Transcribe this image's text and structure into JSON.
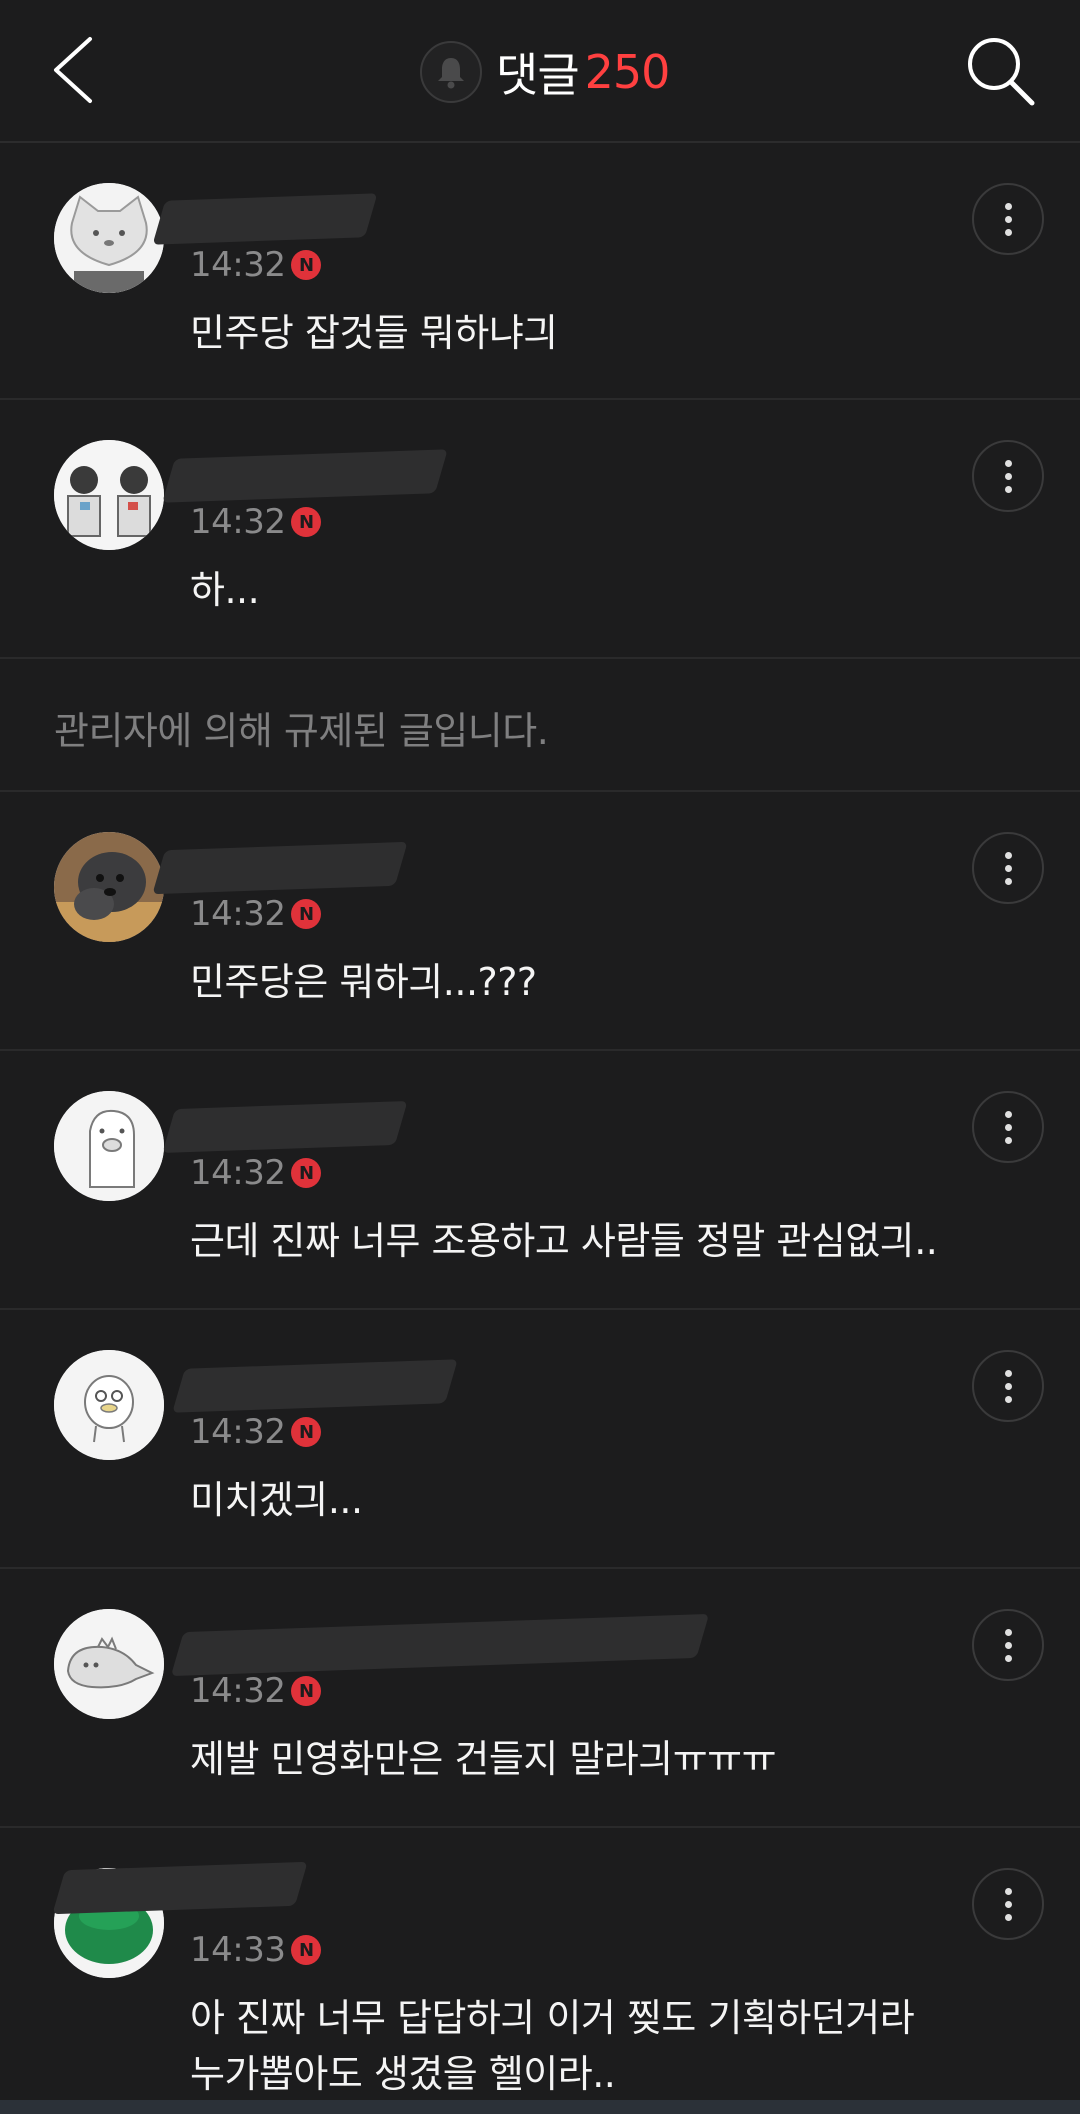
{
  "header": {
    "title": "댓글",
    "count": "250",
    "count_color": "#ff4040",
    "back_icon": "chevron-left-icon",
    "bell_icon": "bell-icon",
    "search_icon": "search-icon"
  },
  "blocked_notice": "관리자에 의해 규제된 글입니다.",
  "comments": [
    {
      "time": "14:32",
      "badge": "N",
      "text": "민주당 잡것들 뭐하냐긔"
    },
    {
      "time": "14:32",
      "badge": "N",
      "text": "하..."
    },
    {
      "time": "14:32",
      "badge": "N",
      "text": "민주당은 뭐하긔...???"
    },
    {
      "time": "14:32",
      "badge": "N",
      "text": "근데 진짜 너무 조용하고 사람들 정말 관심없긔.."
    },
    {
      "time": "14:32",
      "badge": "N",
      "text": "미치겠긔..."
    },
    {
      "time": "14:32",
      "badge": "N",
      "text": "제발 민영화만은 건들지 말라긔ㅠㅠㅠ"
    },
    {
      "time": "14:33",
      "badge": "N",
      "text": "아 진짜 너무 답답하긔 이거 찢도 기획하던거라\n누가뽑아도 생겼을 헬이라.."
    }
  ]
}
